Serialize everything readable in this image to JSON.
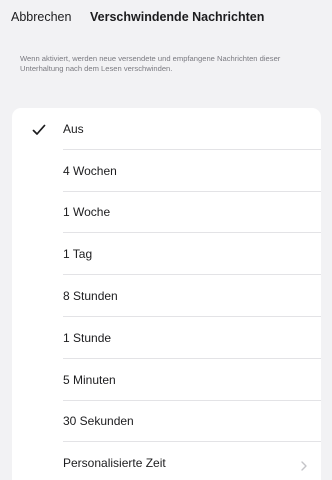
{
  "nav": {
    "cancel_label": "Abbrechen",
    "title": "Verschwindende Nachrichten"
  },
  "description": "Wenn aktiviert, werden neue versendete und empfangene Nachrichten dieser Unterhaltung nach dem Lesen verschwinden.",
  "options": [
    {
      "label": "Aus",
      "selected": true
    },
    {
      "label": "4 Wochen",
      "selected": false
    },
    {
      "label": "1 Woche",
      "selected": false
    },
    {
      "label": "1 Tag",
      "selected": false
    },
    {
      "label": "8 Stunden",
      "selected": false
    },
    {
      "label": "1 Stunde",
      "selected": false
    },
    {
      "label": "5 Minuten",
      "selected": false
    },
    {
      "label": "30 Sekunden",
      "selected": false
    },
    {
      "label": "Personalisierte Zeit",
      "selected": false,
      "disclosure": true
    }
  ],
  "icons": {
    "selected": "checkmark-icon",
    "disclosure": "chevron-right-icon"
  },
  "colors": {
    "background": "#f2f2f4",
    "card": "#ffffff",
    "text": "#1c1c1e",
    "secondary_text": "#7a7a80",
    "separator": "#e3e3e6",
    "chevron": "#c4c4c8"
  }
}
